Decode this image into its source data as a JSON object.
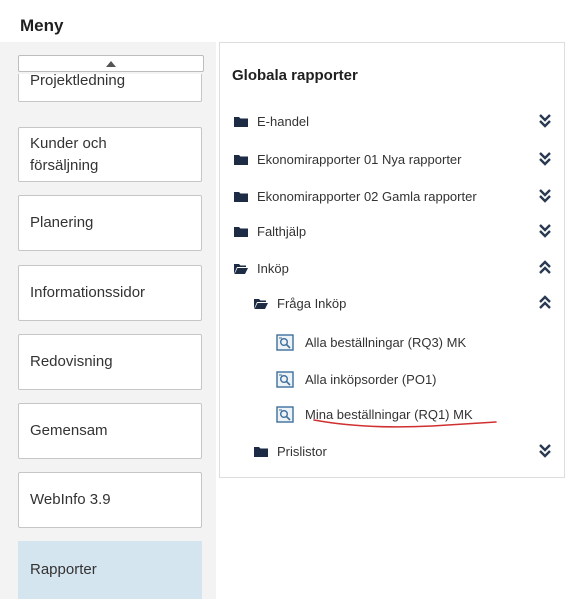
{
  "menu": {
    "title": "Meny",
    "items": [
      {
        "label": "Projektledning",
        "active": false
      },
      {
        "label": "Kunder och\nförsäljning",
        "active": false
      },
      {
        "label": "Planering",
        "active": false
      },
      {
        "label": "Informationssidor",
        "active": false
      },
      {
        "label": "Redovisning",
        "active": false
      },
      {
        "label": "Gemensam",
        "active": false
      },
      {
        "label": "WebInfo 3.9",
        "active": false
      },
      {
        "label": "Rapporter",
        "active": true
      }
    ]
  },
  "panel": {
    "title": "Globala rapporter",
    "tree": [
      {
        "label": "E-handel",
        "type": "folder",
        "state": "collapsed",
        "level": 0
      },
      {
        "label": "Ekonomirapporter 01 Nya rapporter",
        "type": "folder",
        "state": "collapsed",
        "level": 0
      },
      {
        "label": "Ekonomirapporter 02 Gamla rapporter",
        "type": "folder",
        "state": "collapsed",
        "level": 0
      },
      {
        "label": "Falthjälp",
        "type": "folder",
        "state": "collapsed",
        "level": 0
      },
      {
        "label": "Inköp",
        "type": "folder",
        "state": "expanded",
        "level": 0
      },
      {
        "label": "Fråga Inköp",
        "type": "folder",
        "state": "expanded",
        "level": 1
      },
      {
        "label": "Alla beställningar (RQ3) MK",
        "type": "report",
        "level": 2
      },
      {
        "label": "Alla inköpsorder (PO1)",
        "type": "report",
        "level": 2
      },
      {
        "label": "Mina beställningar (RQ1) MK",
        "type": "report",
        "level": 2,
        "annotated": true
      },
      {
        "label": "Prislistor",
        "type": "folder",
        "state": "collapsed",
        "level": 1
      }
    ]
  },
  "colors": {
    "folder_icon": "#1d2b45",
    "chevron": "#2a3a52",
    "active_item_bg": "#d5e5ef",
    "report_icon": "#3d6f9c",
    "annotation_line": "#d03030"
  }
}
